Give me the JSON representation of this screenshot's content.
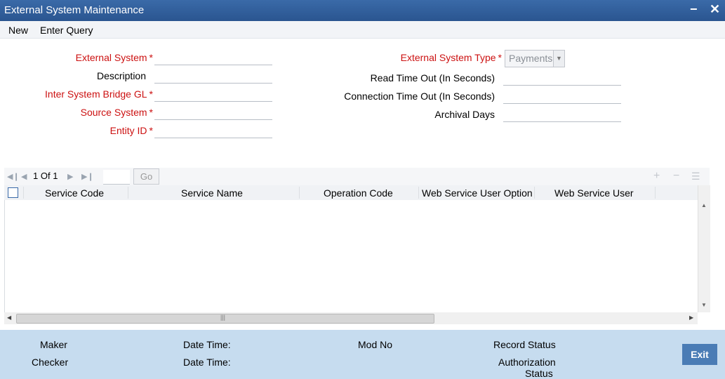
{
  "window": {
    "title": "External System Maintenance",
    "minimize_glyph": "−",
    "close_glyph": "✕"
  },
  "menu": {
    "items": [
      "New",
      "Enter Query"
    ]
  },
  "form": {
    "left": [
      {
        "label": "External System",
        "required": true
      },
      {
        "label": "Description",
        "required": false
      },
      {
        "label": "Inter System Bridge GL",
        "required": true
      },
      {
        "label": "Source System",
        "required": true
      },
      {
        "label": "Entity ID",
        "required": true
      }
    ],
    "right": {
      "type_label": "External System Type",
      "type_value": "Payments",
      "read_timeout_label": "Read Time Out (In Seconds)",
      "conn_timeout_label": "Connection Time Out (In Seconds)",
      "archival_label": "Archival Days"
    },
    "required_marker": "*"
  },
  "grid": {
    "page_current": "1",
    "page_of": "Of",
    "page_total": "1",
    "go_label": "Go",
    "columns": [
      "Service Code",
      "Service Name",
      "Operation Code",
      "Web Service User Option",
      "Web Service User"
    ],
    "rows": []
  },
  "footer": {
    "maker": "Maker",
    "checker": "Checker",
    "date_time_1": "Date Time:",
    "date_time_2": "Date Time:",
    "mod_no": "Mod No",
    "record_status": "Record Status",
    "auth_status_1": "Authorization",
    "auth_status_2": "Status",
    "exit_label": "Exit"
  },
  "colors": {
    "title_bar": "#2f5f9c",
    "required": "#cc1111",
    "footer": "#c6dcef",
    "exit_button": "#4a7cb5"
  }
}
